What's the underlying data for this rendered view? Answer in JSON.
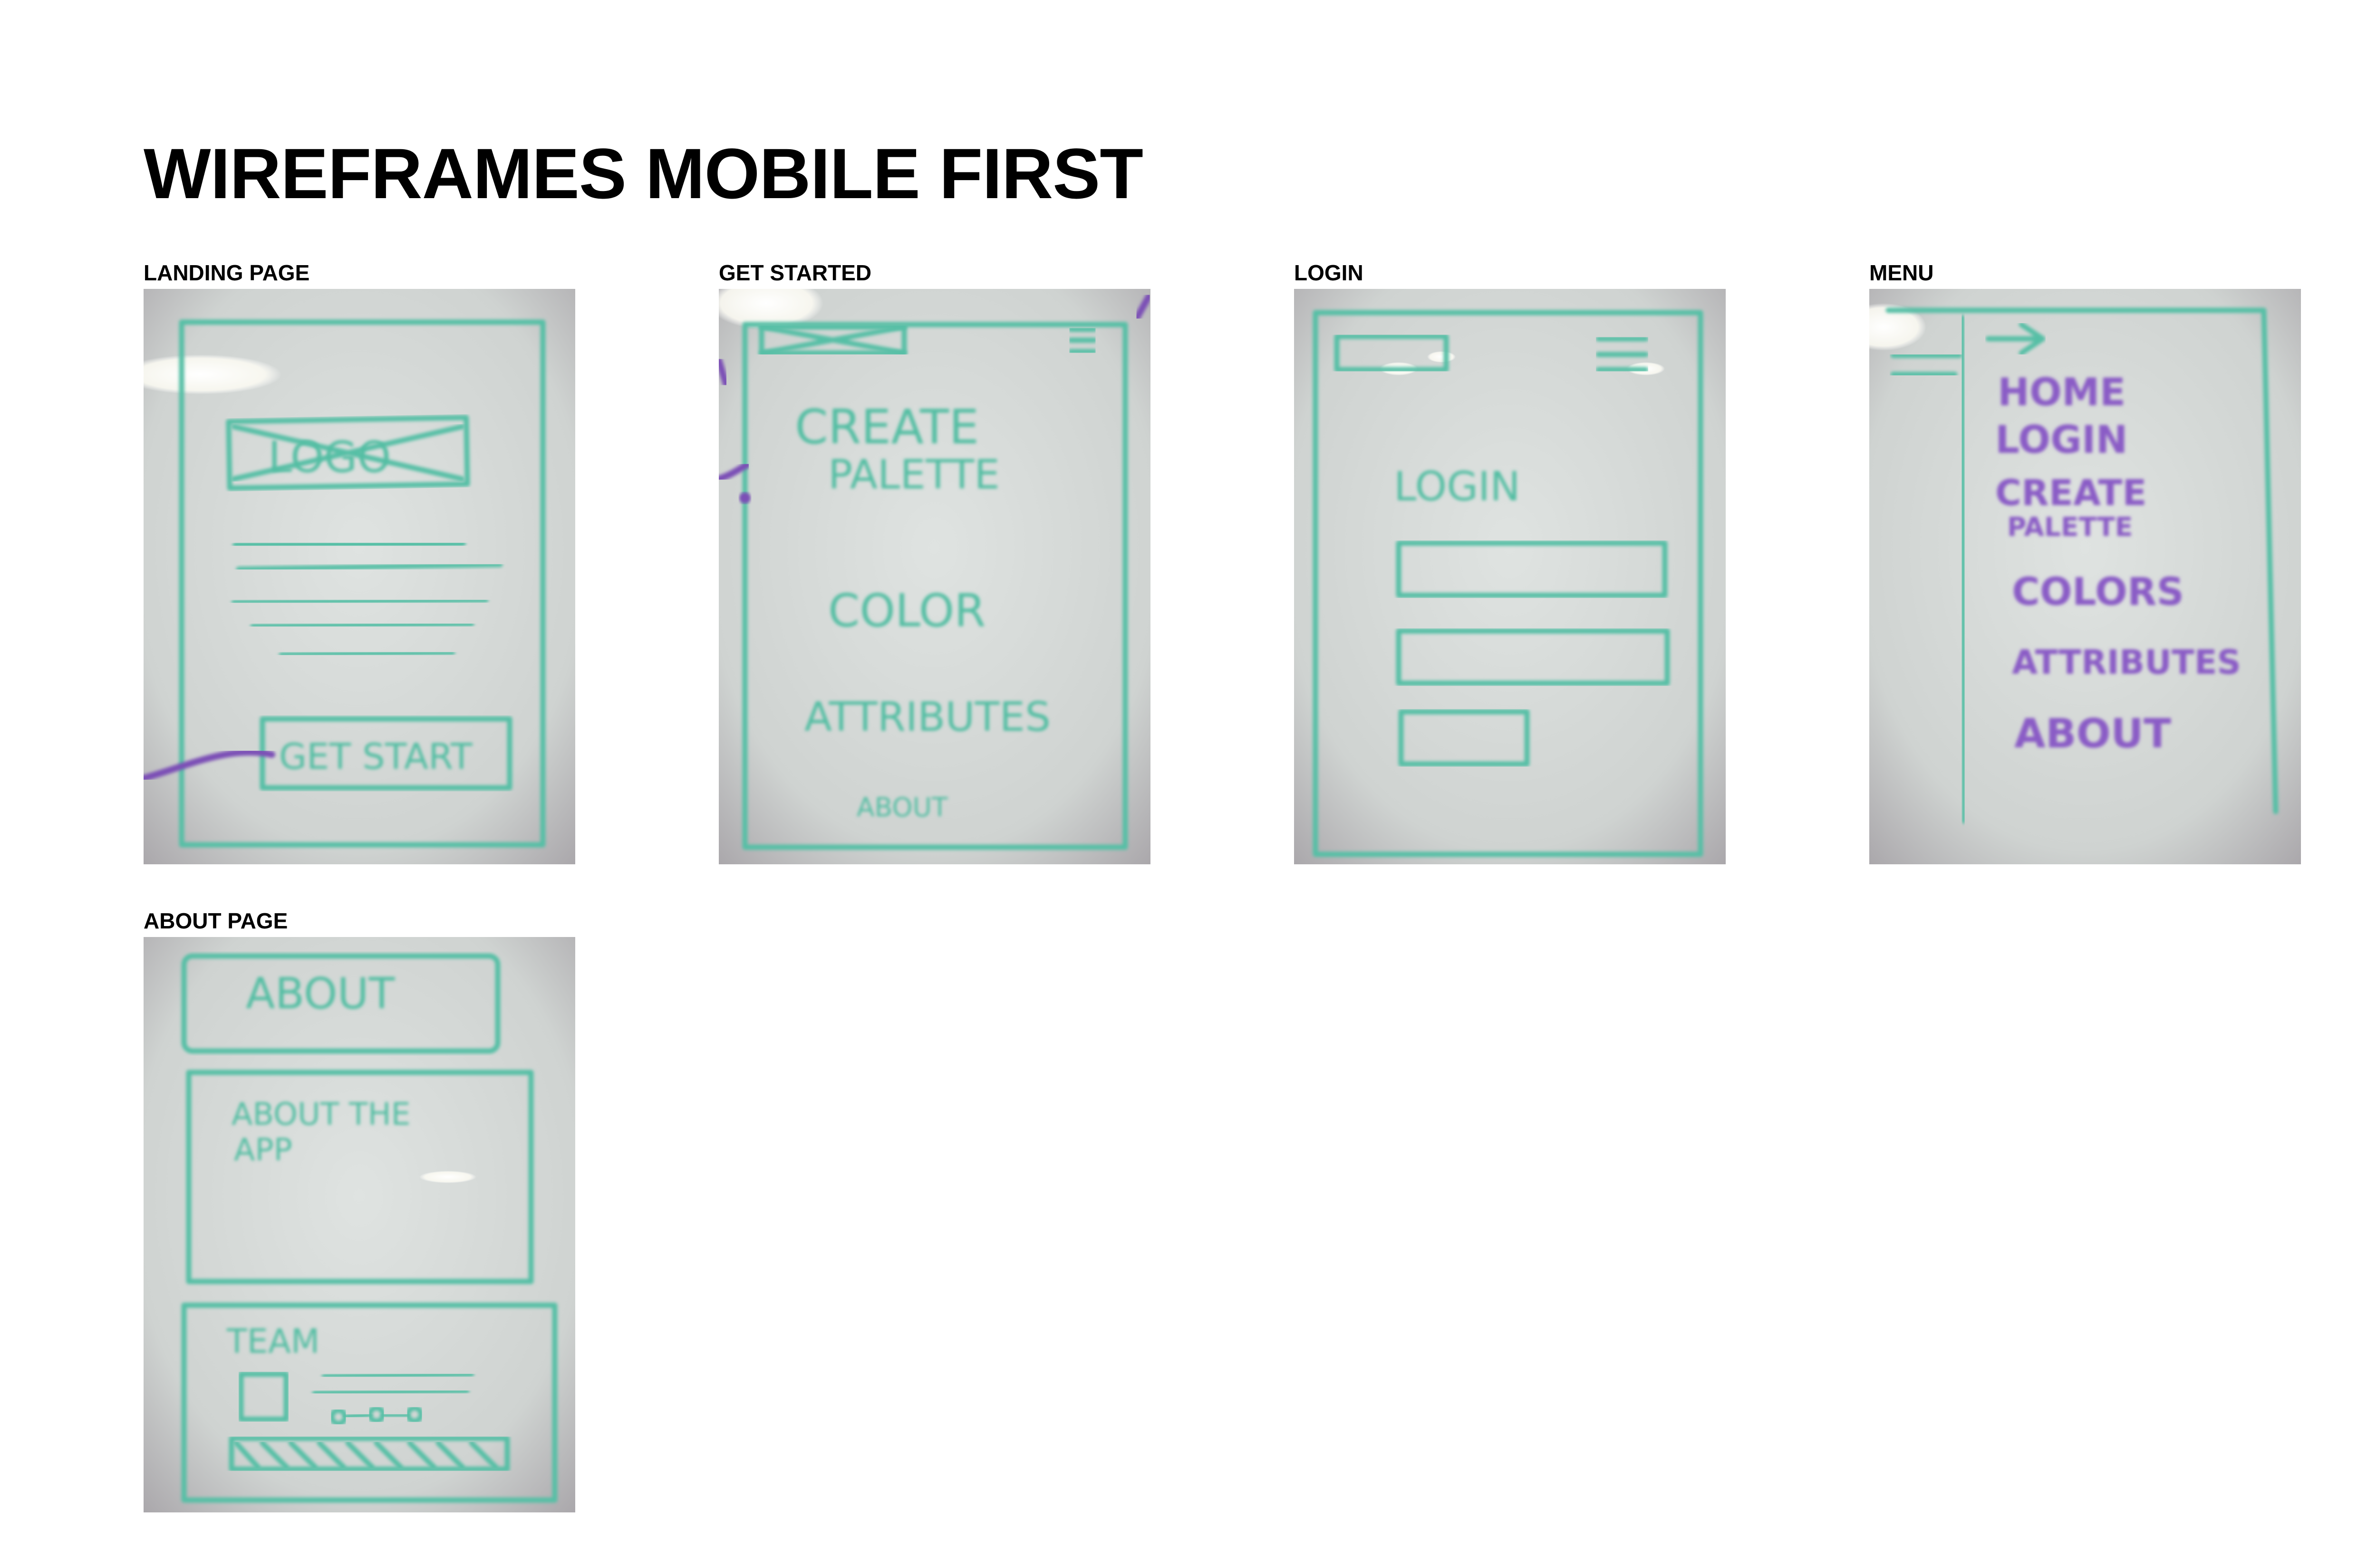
{
  "page": {
    "title": "WIREFRAMES MOBILE FIRST"
  },
  "frames": [
    {
      "label": "LANDING PAGE",
      "sketch_text": [
        "LOGO",
        "GET START"
      ]
    },
    {
      "label": "GET STARTED",
      "sketch_text": [
        "CREATE",
        "PALETTE",
        "COLOR",
        "ATTRIBUTES",
        "ABOUT"
      ]
    },
    {
      "label": "LOGIN",
      "sketch_text": [
        "LOGIN"
      ]
    },
    {
      "label": "MENU",
      "sketch_text": [
        "HOME",
        "LOGIN",
        "CREATE",
        "PALETTE",
        "COLORS",
        "ATTRIBUTES",
        "ABOUT"
      ]
    },
    {
      "label": "ABOUT PAGE",
      "sketch_text": [
        "ABOUT",
        "ABOUT THE",
        "APP",
        "TEAM"
      ]
    }
  ],
  "colors": {
    "marker_green": "#56bfa6",
    "marker_purple": "#7b4fb6",
    "whiteboard": "#cdd1cf"
  }
}
